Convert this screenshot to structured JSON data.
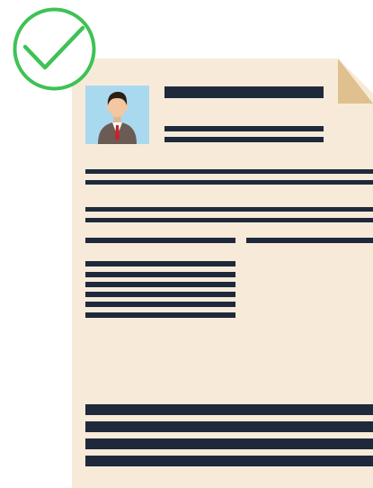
{
  "colors": {
    "check": "#3ec255",
    "paper": "#f7ead9",
    "fold": "#dfc08e",
    "text_lines": "#1e2a3b",
    "photo_bg": "#a9d9ee",
    "suit": "#6a5c55",
    "shirt": "#ffffff",
    "tie": "#c8232c",
    "skin": "#f3c7a0",
    "hair": "#2b1e14"
  },
  "icons": {
    "status": "checkmark-circle-icon",
    "photo": "person-avatar-icon",
    "corner": "folded-corner-icon"
  }
}
